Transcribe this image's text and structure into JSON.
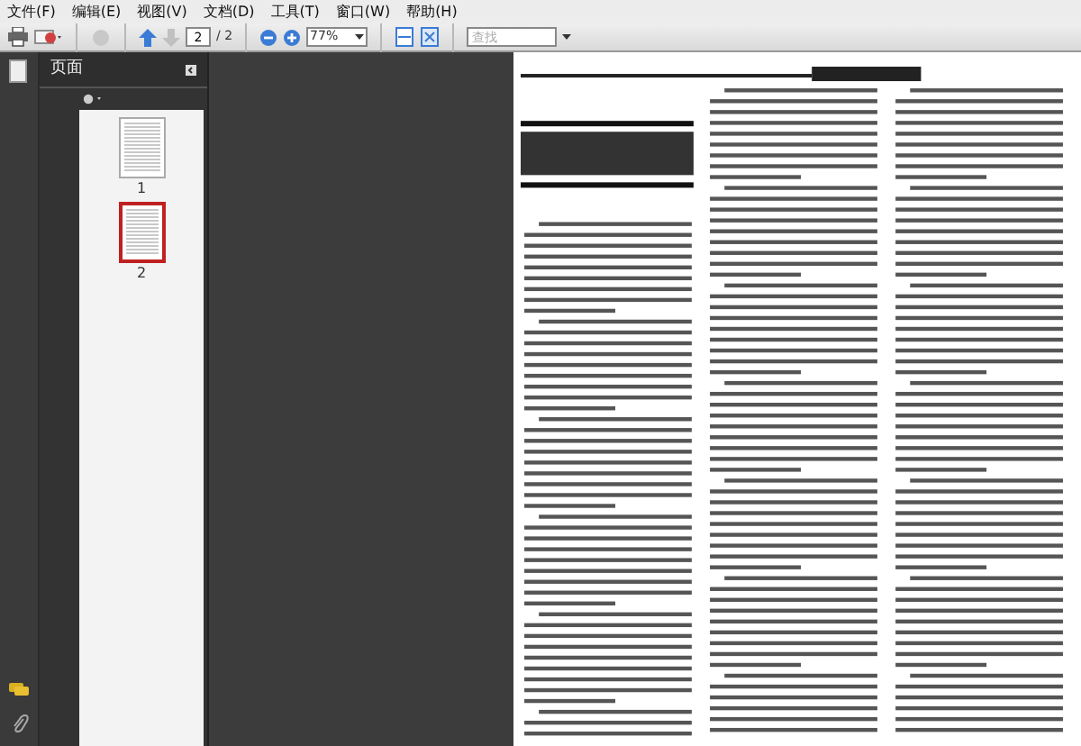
{
  "menu": [
    "文件(F)",
    "编辑(E)",
    "视图(V)",
    "文档(D)",
    "工具(T)",
    "窗口(W)",
    "帮助(H)"
  ],
  "toolbar": {
    "page_value": "2",
    "page_total": "/ 2",
    "zoom": "77%",
    "search_placeholder": "查找"
  },
  "panel": {
    "title": "页面",
    "thumbnails": [
      {
        "label": "1",
        "selected": false
      },
      {
        "label": "2",
        "selected": true
      }
    ]
  }
}
